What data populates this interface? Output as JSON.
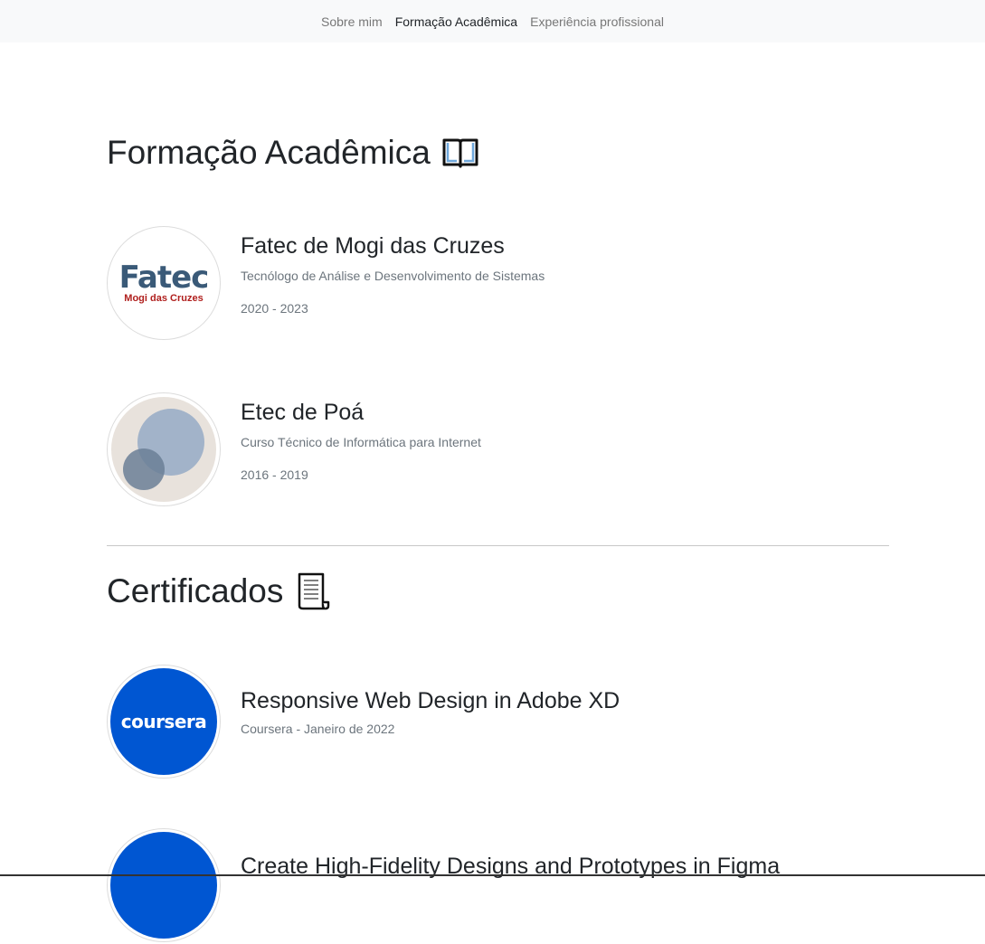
{
  "nav": {
    "items": [
      {
        "label": "Sobre mim"
      },
      {
        "label": "Formação Acadêmica"
      },
      {
        "label": "Experiência profissional"
      }
    ]
  },
  "formacao": {
    "title": "Formação Acadêmica",
    "icon": "open-book-icon",
    "items": [
      {
        "logo_text": "Fatec",
        "logo_subtext": "Mogi das Cruzes",
        "title": "Fatec de Mogi das Cruzes",
        "subtitle": "Tecnólogo de Análise e Desenvolvimento de Sistemas",
        "years": "2020 - 2023"
      },
      {
        "title": "Etec de Poá",
        "subtitle": "Curso Técnico de Informática para Internet",
        "years": "2016 - 2019"
      }
    ]
  },
  "certificados": {
    "title": "Certificados",
    "icon": "scroll-icon",
    "items": [
      {
        "logo_text": "coursera",
        "title": "Responsive Web Design in Adobe XD",
        "subtitle": "Coursera - Janeiro de 2022"
      },
      {
        "title": "Create High-Fidelity Designs and Prototypes in Figma"
      }
    ]
  },
  "colors": {
    "fatec_blue": "#3a5a78",
    "fatec_red": "#b0201e",
    "coursera_blue": "#0056d2",
    "etec_bg": "#e8e2dc",
    "etec_light": "#a2b3c9",
    "etec_dark": "#6b7f97"
  }
}
